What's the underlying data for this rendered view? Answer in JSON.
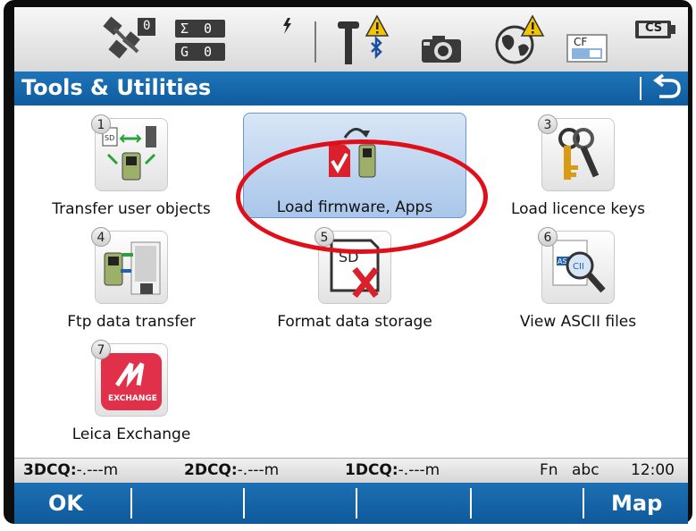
{
  "status_bar": {
    "satellites_count": "0",
    "sigma_counter": "Σ 0",
    "g_counter": "G 0",
    "cf_label": "CF",
    "cs_label": "CS"
  },
  "title_bar": {
    "title": "Tools & Utilities",
    "back_icon": "return-arrow-icon"
  },
  "tiles": [
    {
      "number": "1",
      "label": "Transfer user objects",
      "icon": "transfer-user-objects-icon"
    },
    {
      "number": "",
      "label": "Load firmware, Apps",
      "icon": "load-firmware-icon",
      "selected": true
    },
    {
      "number": "3",
      "label": "Load licence keys",
      "icon": "keys-icon"
    },
    {
      "number": "4",
      "label": "Ftp data transfer",
      "icon": "ftp-transfer-icon"
    },
    {
      "number": "5",
      "label": "Format data storage",
      "icon": "format-sd-icon"
    },
    {
      "number": "6",
      "label": "View ASCII files",
      "icon": "ascii-magnifier-icon"
    },
    {
      "number": "7",
      "label": "Leica Exchange",
      "icon": "leica-exchange-icon",
      "icon_text": "EXCHANGE"
    }
  ],
  "info_bar": {
    "q3_label": "3DCQ:",
    "q3_value": "-.---m",
    "q2_label": "2DCQ:",
    "q2_value": "-.---m",
    "q1_label": "1DCQ:",
    "q1_value": "-.---m",
    "fn": "Fn",
    "input_mode": "abc",
    "time": "12:00"
  },
  "softkeys": {
    "ok": "OK",
    "map": "Map"
  },
  "colors": {
    "bar_blue": "#1469ad",
    "highlight_red": "#e0101a",
    "warning_yellow": "#f5c400"
  }
}
